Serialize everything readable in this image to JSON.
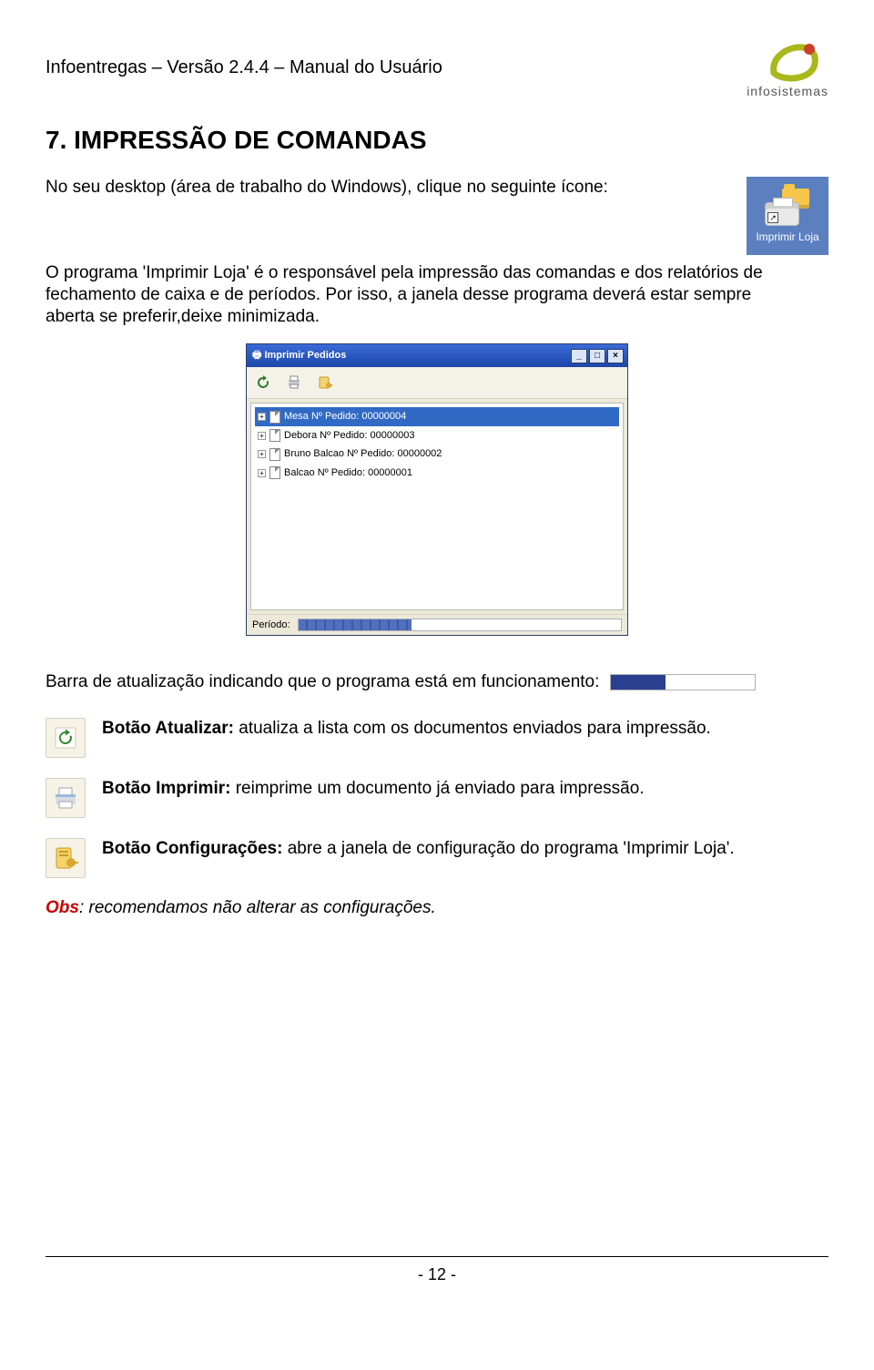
{
  "header": {
    "doc_title": "Infoentregas – Versão 2.4.4 – Manual do Usuário",
    "brand": "infosistemas"
  },
  "section": {
    "number": "7.",
    "title": "IMPRESSÃO DE COMANDAS"
  },
  "intro": {
    "p1": "No seu desktop (área de trabalho do Windows), clique no seguinte ícone:",
    "p2": "O programa 'Imprimir Loja' é o responsável pela impressão das comandas e dos relatórios de fechamento de caixa e de períodos. Por isso, a janela desse programa deverá estar sempre aberta se preferir,deixe minimizada."
  },
  "desktop_icon": {
    "label": "Imprimir Loja"
  },
  "window": {
    "title": "Imprimir Pedidos",
    "tree_items": [
      "Mesa Nº Pedido: 00000004",
      "Debora Nº Pedido: 00000003",
      "Bruno Balcao Nº Pedido: 00000002",
      "Balcao Nº Pedido: 00000001"
    ],
    "status_label": "Período:"
  },
  "barra_text": "Barra de atualização indicando que o programa está em funcionamento:",
  "buttons": {
    "atualizar": {
      "title": "Botão Atualizar:",
      "desc": " atualiza a lista com os documentos enviados para impressão."
    },
    "imprimir": {
      "title": "Botão Imprimir:",
      "desc": " reimprime um documento já enviado para impressão."
    },
    "config": {
      "title": "Botão Configurações:",
      "desc": " abre a janela de configuração do programa 'Imprimir Loja'."
    }
  },
  "obs": {
    "label": "Obs",
    "text": ": recomendamos não alterar as configurações."
  },
  "page_number": "- 12 -"
}
